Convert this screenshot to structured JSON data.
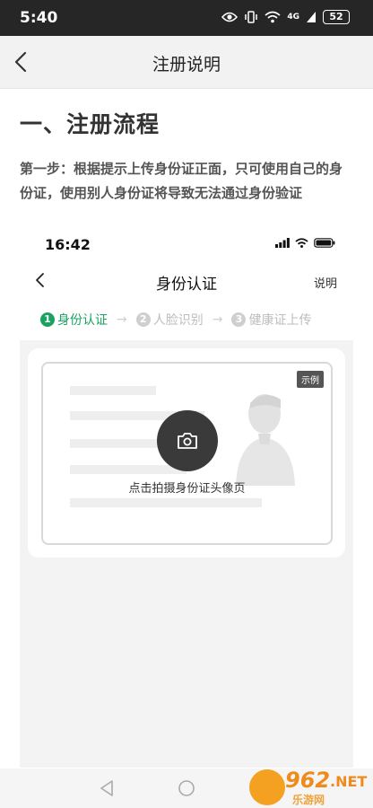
{
  "status_bar": {
    "time": "5:40",
    "signal_label": "4G",
    "battery": "52"
  },
  "app_bar": {
    "title": "注册说明"
  },
  "content": {
    "heading": "一、注册流程",
    "step1_text": "第一步：根据提示上传身份证正面，只可使用自己的身份证，使用别人身份证将导致无法通过身份验证"
  },
  "screenshot": {
    "time": "16:42",
    "title": "身份认证",
    "help": "说明",
    "steps": [
      {
        "num": "1",
        "label": "身份认证"
      },
      {
        "num": "2",
        "label": "人脸识别"
      },
      {
        "num": "3",
        "label": "健康证上传"
      }
    ],
    "arrow": "→",
    "example_badge": "示例",
    "capture_caption": "点击拍摄身份证头像页"
  },
  "watermark": {
    "number": "962",
    "suffix": ".NET",
    "cn": "乐游网"
  },
  "colors": {
    "accent": "#1aa260",
    "status_bar_bg": "#262626",
    "app_bar_bg": "#f2f2f2"
  }
}
